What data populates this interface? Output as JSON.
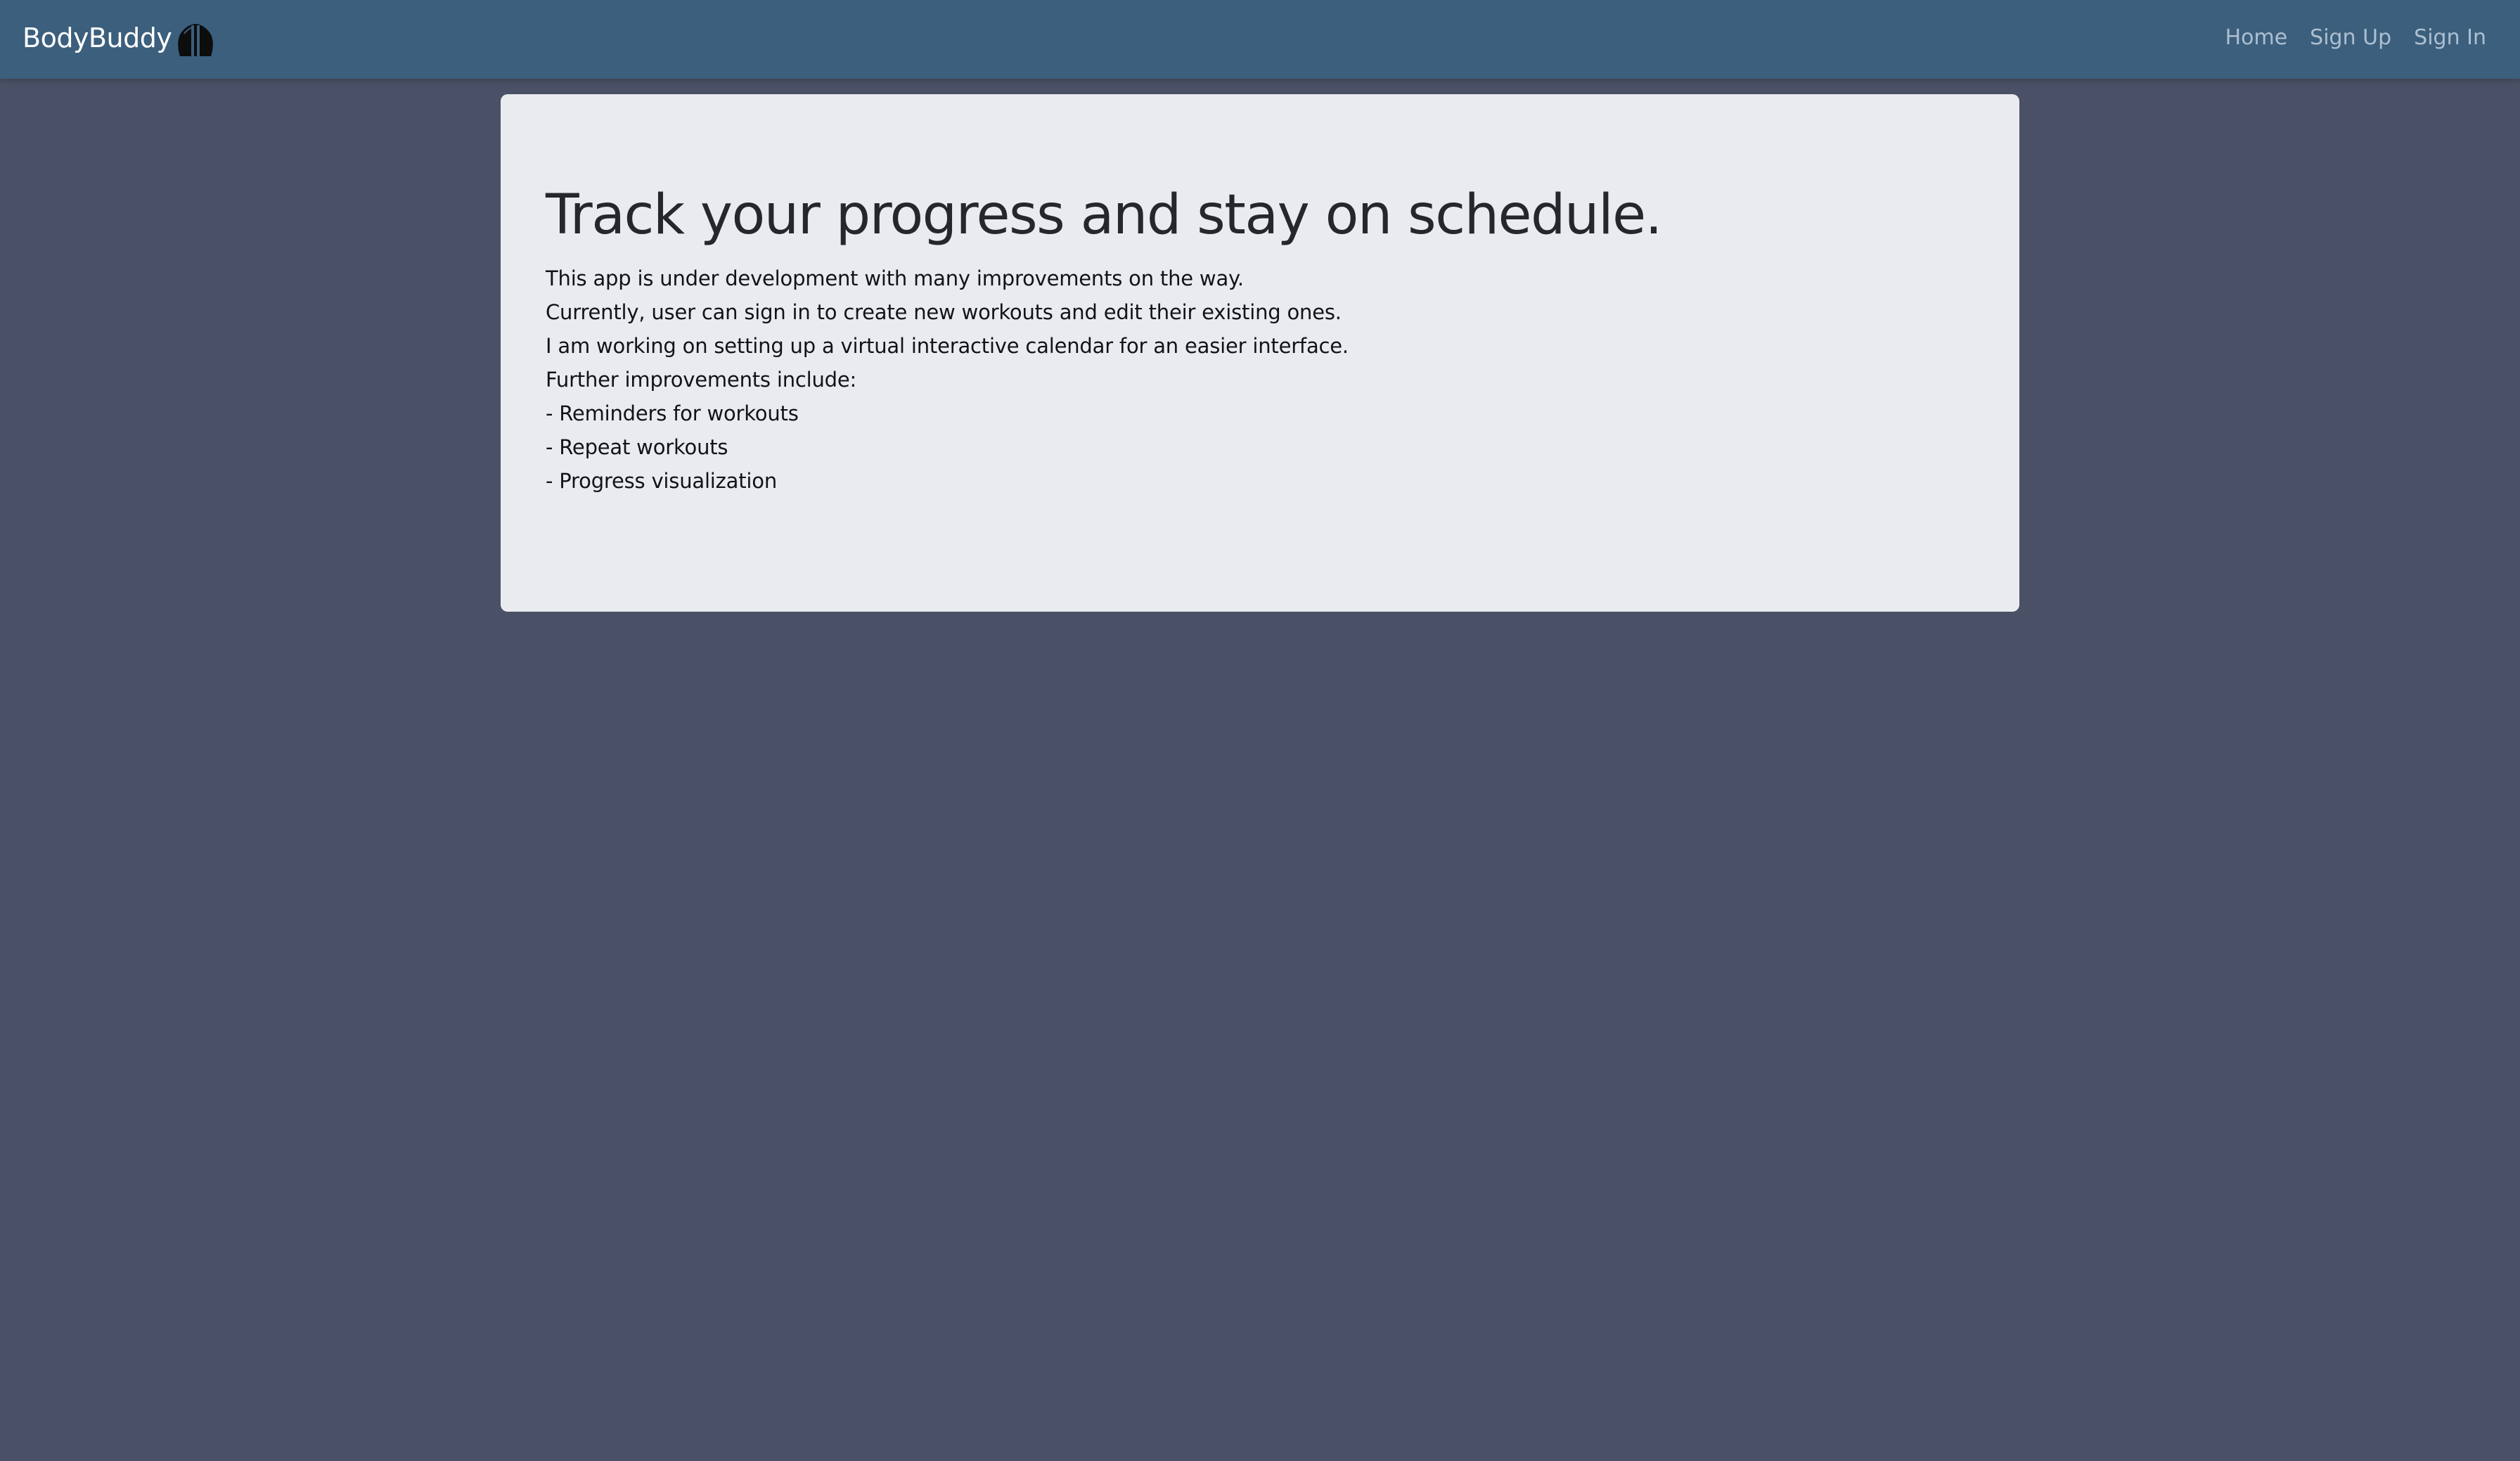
{
  "navbar": {
    "brand": "BodyBuddy",
    "brand_icon": "muscle-icon",
    "links": [
      "Home",
      "Sign Up",
      "Sign In"
    ]
  },
  "main": {
    "headline": "Track your progress and stay on schedule.",
    "lines": [
      "This app is under development with many improvements on the way.",
      "Currently, user can sign in to create new workouts and edit their existing ones.",
      "I am working on setting up a virtual interactive calendar for an easier interface.",
      "Further improvements include:",
      "- Reminders for workouts",
      "- Repeat workouts",
      "- Progress visualization"
    ]
  },
  "colors": {
    "navbar": "#3b5f7d",
    "background": "#4a5065",
    "card": "#e9ebef",
    "nav_link": "#aebfd0"
  }
}
